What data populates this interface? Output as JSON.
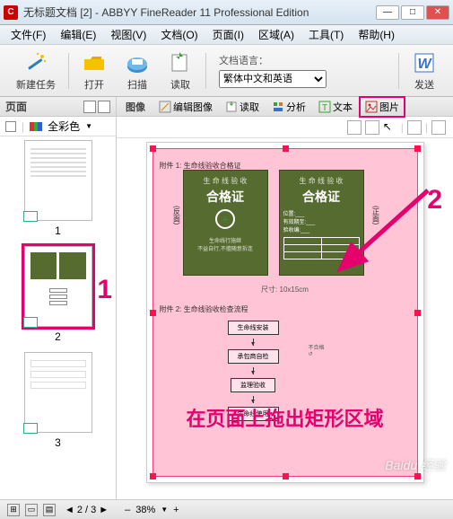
{
  "titlebar": {
    "title": "无标题文档 [2] - ABBYY FineReader 11 Professional Edition",
    "app_icon_letter": "C"
  },
  "menubar": [
    "文件(F)",
    "编辑(E)",
    "视图(V)",
    "文档(O)",
    "页面(I)",
    "区域(A)",
    "工具(T)",
    "帮助(H)"
  ],
  "toolbar": {
    "new_task": "新建任务",
    "open": "打开",
    "scan": "扫描",
    "read": "读取",
    "lang_label": "文档语言：",
    "lang_value": "繁体中文和英语",
    "send": "发送"
  },
  "left_panel": {
    "header": "页面",
    "fullcolor": "全彩色"
  },
  "thumbs": [
    {
      "num": "1",
      "active": false
    },
    {
      "num": "2",
      "active": true
    },
    {
      "num": "3",
      "active": false
    }
  ],
  "image_panel": {
    "header": "图像",
    "edit_image": "编辑图像",
    "read": "读取",
    "analyze": "分析",
    "text_btn": "文本",
    "pic_btn": "图片"
  },
  "page_content": {
    "caption1": "附件 1: 生命线验收合格证",
    "caption2": "附件 2: 生命线验收检查流程",
    "cert_sub": "生 命 线 验 收",
    "cert_title": "合格证",
    "cert_plus": "+",
    "vert_left": "(反面)",
    "vert_right": "(正面)",
    "size": "尺寸: 10x15cm",
    "flow1": "生命线安装",
    "flow2": "承包商自检",
    "flow3": "监理验收",
    "flow4": "生命线使用"
  },
  "annotations": {
    "num1": "1",
    "num2": "2",
    "overlay": "在页面上拖出矩形区域"
  },
  "statusbar": {
    "page_current": "2",
    "page_total": "3",
    "zoom": "38%"
  },
  "watermark": "Baidu 经验"
}
